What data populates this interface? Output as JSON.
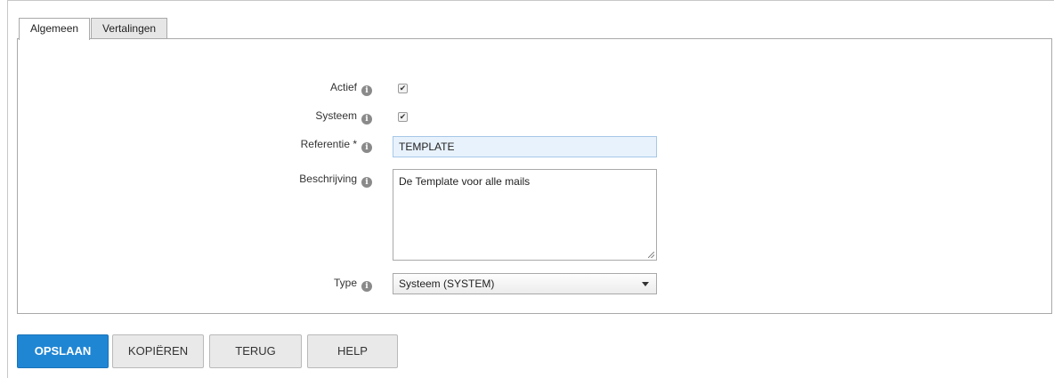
{
  "tabs": [
    {
      "label": "Algemeen",
      "active": true
    },
    {
      "label": "Vertalingen",
      "active": false
    }
  ],
  "form": {
    "actief": {
      "label": "Actief",
      "checked": true
    },
    "systeem": {
      "label": "Systeem",
      "checked": true
    },
    "referentie": {
      "label": "Referentie *",
      "value": "TEMPLATE"
    },
    "beschrijving": {
      "label": "Beschrijving",
      "value": "De Template voor alle mails"
    },
    "type": {
      "label": "Type",
      "value": "Systeem (SYSTEM)"
    }
  },
  "info_icon_glyph": "i",
  "checkmark_glyph": "✔",
  "buttons": {
    "save": "OPSLAAN",
    "copy": "KOPIËREN",
    "back": "TERUG",
    "help": "HELP"
  },
  "colors": {
    "primary_button": "#1f86d4",
    "input_highlight": "#e8f2fc"
  }
}
